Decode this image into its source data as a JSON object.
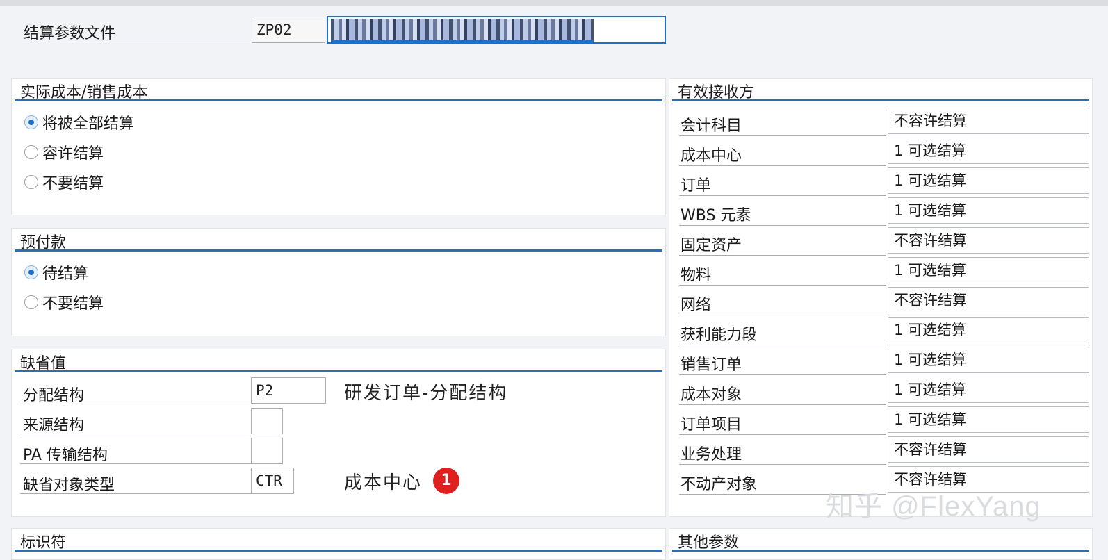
{
  "header": {
    "label": "结算参数文件",
    "profile_code": "ZP02"
  },
  "actual_cost": {
    "title": "实际成本/销售成本",
    "options": [
      {
        "label": "将被全部结算",
        "checked": true
      },
      {
        "label": "容许结算",
        "checked": false
      },
      {
        "label": "不要结算",
        "checked": false
      }
    ]
  },
  "prepayment": {
    "title": "预付款",
    "options": [
      {
        "label": "待结算",
        "checked": true
      },
      {
        "label": "不要结算",
        "checked": false
      }
    ]
  },
  "defaults": {
    "title": "缺省值",
    "rows": [
      {
        "label": "分配结构",
        "value": "P2",
        "desc": "研发订单-分配结构"
      },
      {
        "label": "来源结构",
        "value": "",
        "desc": ""
      },
      {
        "label": "PA 传输结构",
        "value": "",
        "desc": ""
      },
      {
        "label": "缺省对象类型",
        "value": "CTR",
        "desc": "成本中心",
        "badge": "1"
      }
    ]
  },
  "receivers": {
    "title": "有效接收方",
    "rows": [
      {
        "label": "会计科目",
        "value": "不容许结算"
      },
      {
        "label": "成本中心",
        "value": "1 可选结算"
      },
      {
        "label": "订单",
        "value": "1 可选结算"
      },
      {
        "label": "WBS 元素",
        "value": "1 可选结算"
      },
      {
        "label": "固定资产",
        "value": "不容许结算"
      },
      {
        "label": "物料",
        "value": "1 可选结算"
      },
      {
        "label": "网络",
        "value": "不容许结算"
      },
      {
        "label": "获利能力段",
        "value": "1 可选结算"
      },
      {
        "label": "销售订单",
        "value": "1 可选结算"
      },
      {
        "label": "成本对象",
        "value": "1 可选结算"
      },
      {
        "label": "订单项目",
        "value": "1 可选结算"
      },
      {
        "label": "业务处理",
        "value": "不容许结算"
      },
      {
        "label": "不动产对象",
        "value": "不容许结算"
      }
    ]
  },
  "identifiers": {
    "title": "标识符"
  },
  "other_params": {
    "title": "其他参数"
  },
  "watermark": "知乎 @FlexYang",
  "colors": {
    "accent": "#2e6db5",
    "badge": "#e01f1f",
    "background": "#f2f3f6"
  }
}
